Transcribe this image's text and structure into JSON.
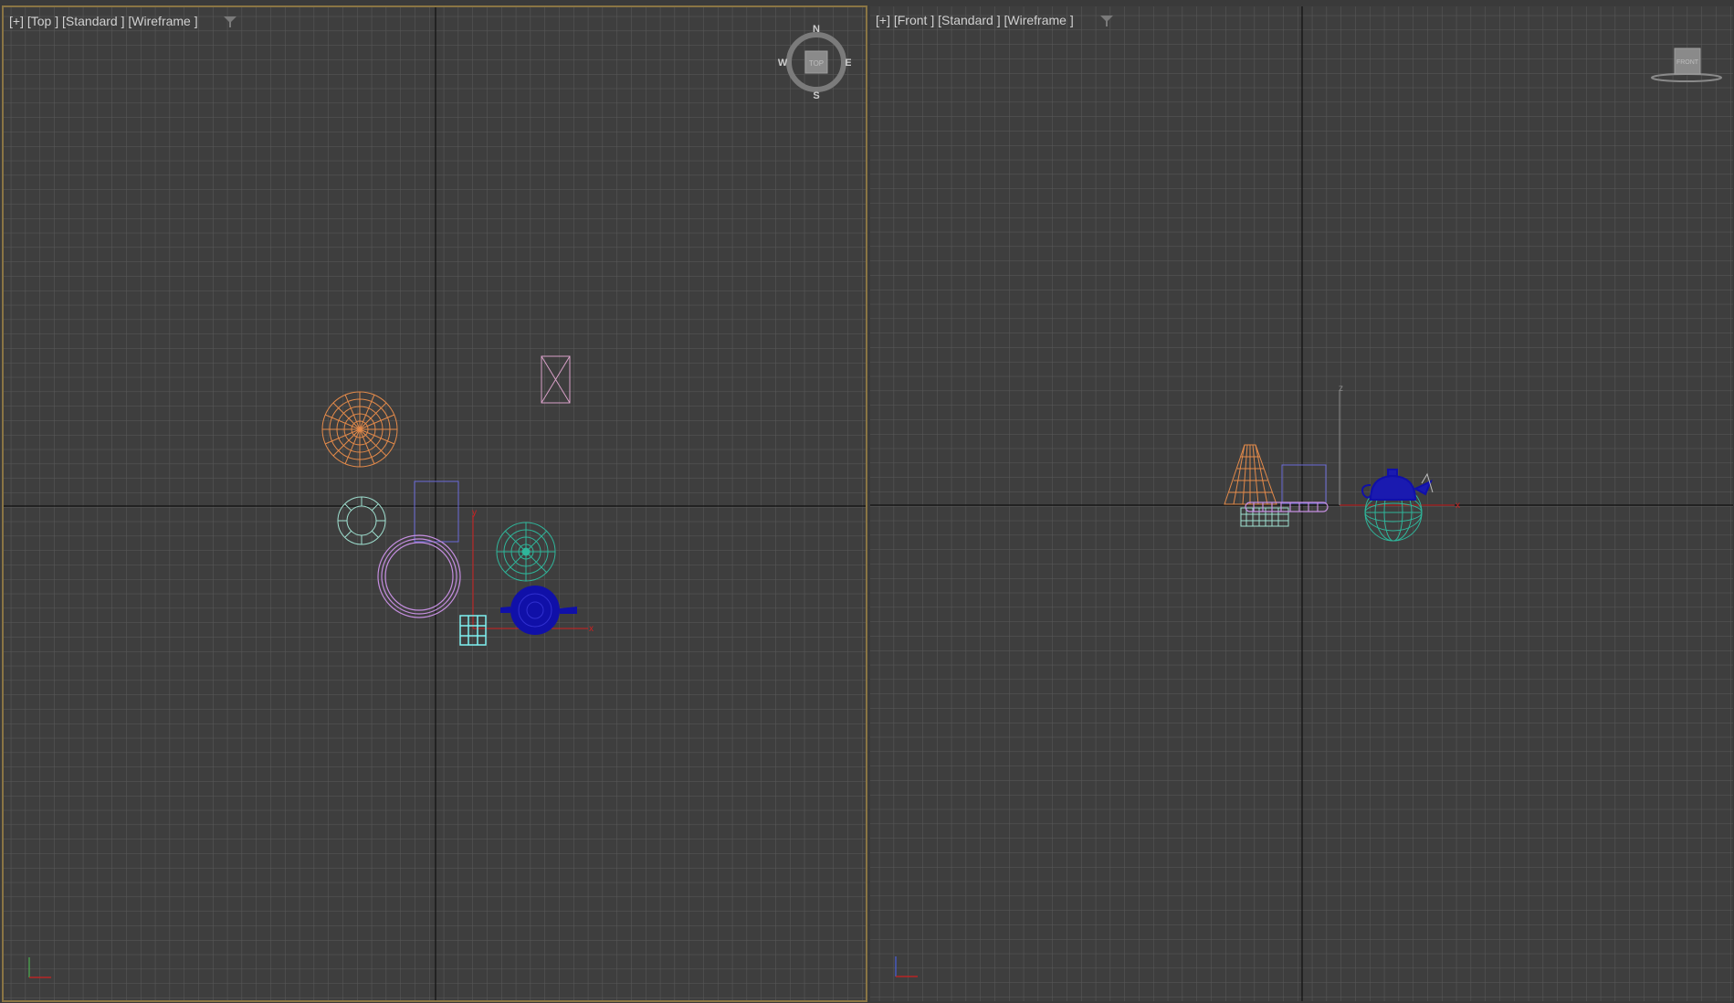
{
  "viewports": [
    {
      "id": "top",
      "labels": {
        "plus": "[+]",
        "view": "[Top ]",
        "shading_mode": "[Standard ]",
        "display": "[Wireframe ]"
      },
      "compass": {
        "n": "N",
        "s": "S",
        "e": "E",
        "w": "W",
        "cube": "TOP"
      },
      "axis_labels": {
        "x": "x",
        "y": "y"
      }
    },
    {
      "id": "front",
      "labels": {
        "plus": "[+]",
        "view": "[Front ]",
        "shading_mode": "[Standard ]",
        "display": "[Wireframe ]"
      },
      "viewcube": {
        "face": "FRONT"
      },
      "axis_labels": {
        "x": "x",
        "z": "z"
      }
    }
  ],
  "colors": {
    "background": "#3e3e3e",
    "grid_minor": "#5a5a5a",
    "grid_major": "#111111",
    "active_border": "#8a7544",
    "orange": "#e38a4a",
    "teal": "#2fb59a",
    "pale_teal": "#9fe0d0",
    "violet": "#c58ee0",
    "blue": "#1010a8",
    "purple_box": "#6a6ad8",
    "pink": "#d8a0c8",
    "cyan": "#7ff0f0"
  }
}
